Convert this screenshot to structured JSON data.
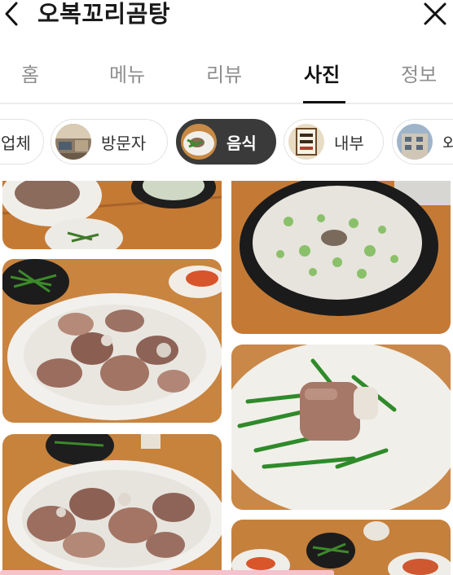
{
  "header": {
    "title": "오복꼬리곰탕",
    "back_icon": "chevron-left-icon",
    "close_icon": "close-icon"
  },
  "tabs": [
    {
      "label": "홈",
      "active": false
    },
    {
      "label": "메뉴",
      "active": false
    },
    {
      "label": "리뷰",
      "active": false
    },
    {
      "label": "사진",
      "active": true
    },
    {
      "label": "정보",
      "active": false
    }
  ],
  "chips": [
    {
      "label": "업체",
      "active": false
    },
    {
      "label": "방문자",
      "active": false
    },
    {
      "label": "음식",
      "active": true
    },
    {
      "label": "내부",
      "active": false
    },
    {
      "label": "외",
      "active": false
    }
  ],
  "colors": {
    "active_chip_bg": "#3a3a3a",
    "tab_active": "#111111",
    "tab_inactive": "#8e8e8e",
    "table_wood": "#c7782e",
    "plate": "#f2f0ec"
  }
}
